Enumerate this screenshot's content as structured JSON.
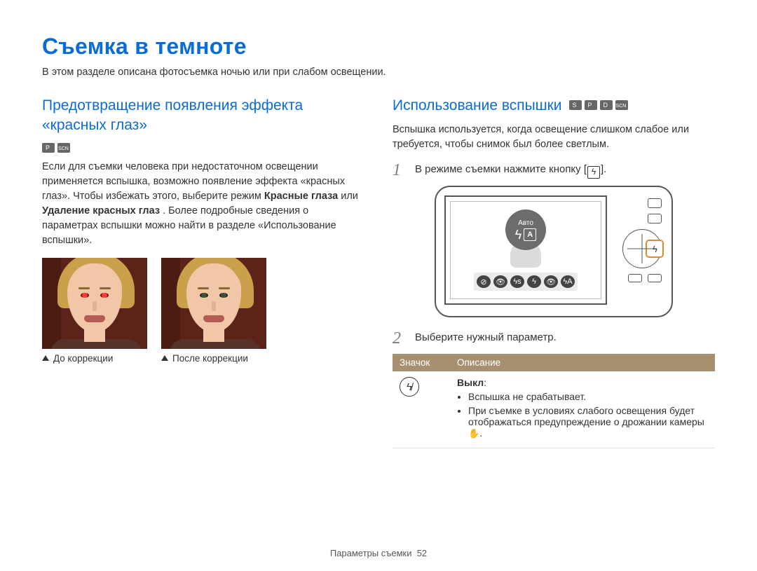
{
  "title": "Съемка в темноте",
  "intro": "В этом разделе описана фотосъемка ночью или при слабом освещении.",
  "left": {
    "heading": "Предотвращение появления эффекта «красных глаз»",
    "mode_icons": [
      "program",
      "scene"
    ],
    "para_before_bold": "Если для съемки человека при недостаточном освещении применяется вспышка, возможно появление эффекта «красных глаз». Чтобы избежать этого, выберите режим ",
    "bold1": "Красные глаза",
    "para_or": " или ",
    "bold2": "Удаление красных глаз",
    "para_after_bold": ". Более подробные сведения о параметрах вспышки можно найти в разделе «Использование вспышки».",
    "caption_before": "До коррекции",
    "caption_after": "После коррекции"
  },
  "right": {
    "heading": "Использование вспышки",
    "mode_icons": [
      "smart",
      "program",
      "dual",
      "scene"
    ],
    "para": "Вспышка используется, когда освещение слишком слабое или требуется, чтобы снимок был более светлым.",
    "step1": "В режиме съемки нажмите кнопку [",
    "step1_tail": "].",
    "camera_auto_label": "Авто",
    "step2": "Выберите нужный параметр.",
    "table": {
      "head_icon": "Значок",
      "head_desc": "Описание",
      "row1": {
        "name": "Выкл",
        "b1": "Вспышка не срабатывает.",
        "b2_before": "При съемке в условиях слабого освещения будет отображаться предупреждение о дрожании камеры ",
        "b2_after": "."
      }
    }
  },
  "footer_section": "Параметры съемки",
  "footer_page": "52"
}
